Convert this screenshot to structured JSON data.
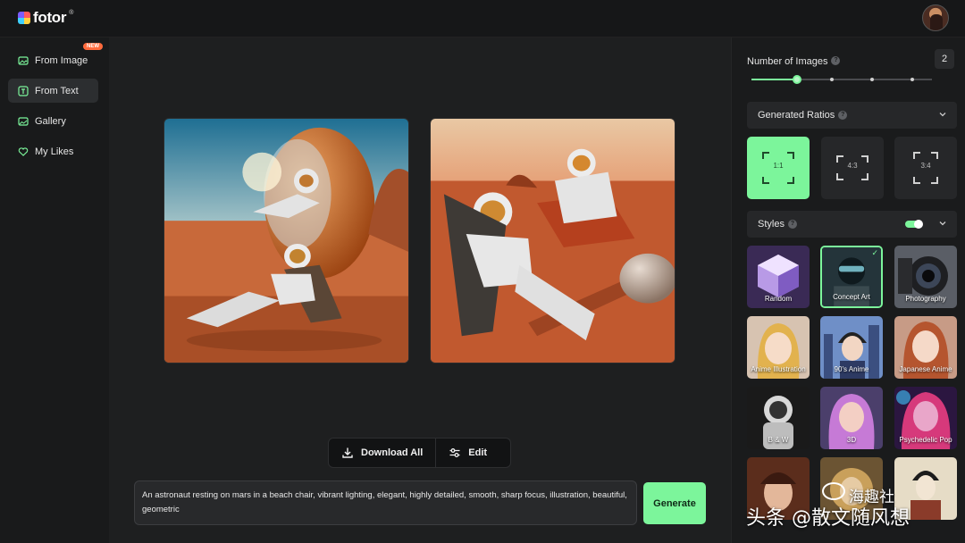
{
  "header": {
    "logo_text": "fotor",
    "logo_reg": "®",
    "avatar": "user-avatar"
  },
  "sidebar": {
    "items": [
      {
        "label": "From Image",
        "icon": "image-icon",
        "badge": "NEW"
      },
      {
        "label": "From Text",
        "icon": "text-icon",
        "active": true
      },
      {
        "label": "Gallery",
        "icon": "gallery-icon"
      },
      {
        "label": "My Likes",
        "icon": "heart-icon"
      }
    ]
  },
  "main": {
    "download_label": "Download All",
    "edit_label": "Edit",
    "prompt": "An astronaut resting on mars in a beach chair, vibrant lighting, elegant, highly detailed, smooth, sharp focus, illustration, beautiful, geometric",
    "generate_label": "Generate"
  },
  "panel": {
    "num_images_label": "Number of Images",
    "num_images_value": "2",
    "slider_fraction": 0.25,
    "ratios_label": "Generated Ratios",
    "ratios": [
      {
        "label": "1:1",
        "active": true
      },
      {
        "label": "4:3",
        "active": false
      },
      {
        "label": "3:4",
        "active": false
      }
    ],
    "styles_label": "Styles",
    "styles_toggle_on": true,
    "styles": [
      {
        "label": "Random"
      },
      {
        "label": "Concept Art",
        "selected": true
      },
      {
        "label": "Photography"
      },
      {
        "label": "Anime Illustration"
      },
      {
        "label": "90's Anime"
      },
      {
        "label": "Japanese Anime"
      },
      {
        "label": "B & W"
      },
      {
        "label": "3D"
      },
      {
        "label": "Psychedelic Pop"
      },
      {
        "label": ""
      },
      {
        "label": ""
      },
      {
        "label": ""
      }
    ]
  },
  "watermark": {
    "top": "海趣社",
    "bottom": "头条 @散文随风想"
  },
  "colors": {
    "accent": "#7cf59b",
    "badge": "#ff6b3d",
    "bg": "#1d1e1f"
  }
}
